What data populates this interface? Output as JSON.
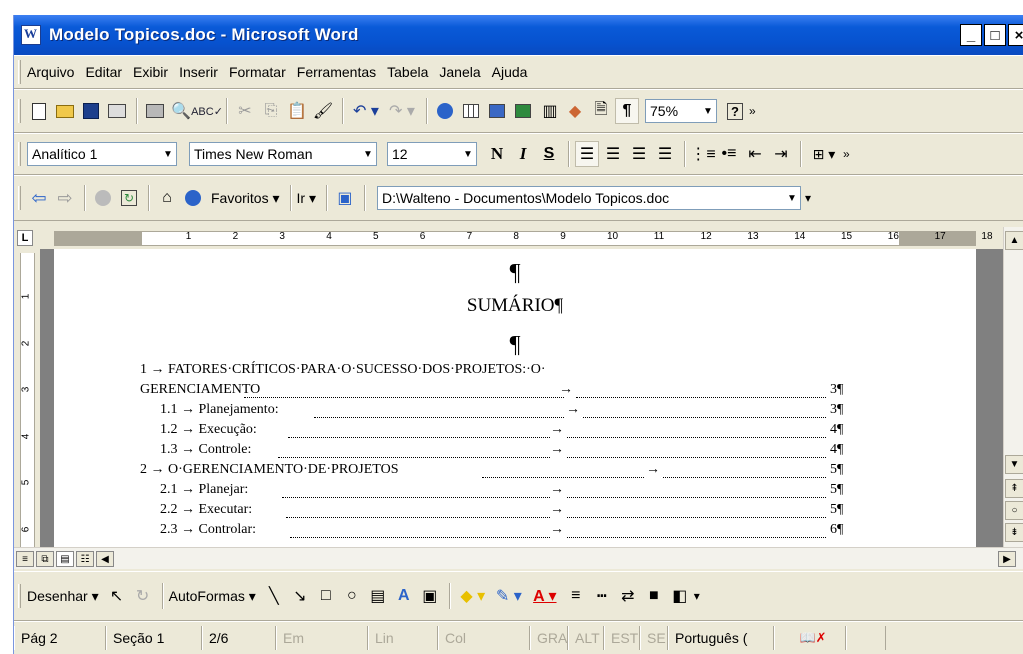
{
  "window": {
    "title": "Modelo Topicos.doc - Microsoft Word"
  },
  "menu": [
    "Arquivo",
    "Editar",
    "Exibir",
    "Inserir",
    "Formatar",
    "Ferramentas",
    "Tabela",
    "Janela",
    "Ajuda"
  ],
  "standard_toolbar": {
    "zoom": "75%"
  },
  "formatting_toolbar": {
    "style": "Analítico 1",
    "font": "Times New Roman",
    "size": "12",
    "bold": "N",
    "italic": "I",
    "underline": "S"
  },
  "web_toolbar": {
    "favorites": "Favoritos",
    "go": "Ir",
    "address": "D:\\Walteno - Documentos\\Modelo Topicos.doc"
  },
  "ruler": {
    "h_numbers": [
      "1",
      "2",
      "3",
      "4",
      "5",
      "6",
      "7",
      "8",
      "9",
      "10",
      "11",
      "12",
      "13",
      "14",
      "15",
      "16",
      "17",
      "18"
    ],
    "v_numbers": [
      "1",
      "2",
      "3",
      "4",
      "5",
      "6"
    ]
  },
  "document": {
    "pilcrow": "¶",
    "title": "SUMÁRIO¶",
    "toc": [
      {
        "text": "1 → FATORES·CRÍTICOS·PARA·O·SUCESSO·DOS·PROJETOS:·O·",
        "page": ""
      },
      {
        "text": "GERENCIAMENTO",
        "page": "3¶"
      },
      {
        "text": "1.1 → Planejamento:",
        "page": "3¶"
      },
      {
        "text": "1.2 → Execução:",
        "page": "4¶"
      },
      {
        "text": "1.3 → Controle:",
        "page": "4¶"
      },
      {
        "text": "2 → O·GERENCIAMENTO·DE·PROJETOS",
        "page": "5¶"
      },
      {
        "text": "2.1 → Planejar:",
        "page": "5¶"
      },
      {
        "text": "2.2 → Executar:",
        "page": "5¶"
      },
      {
        "text": "2.3 → Controlar:",
        "page": "6¶"
      }
    ]
  },
  "drawing_toolbar": {
    "draw": "Desenhar",
    "autoshapes": "AutoFormas"
  },
  "status_bar": {
    "page": "Pág 2",
    "section": "Seção 1",
    "pages": "2/6",
    "at": "Em",
    "line": "Lin",
    "col": "Col",
    "rec": "GRA",
    "trk": "ALT",
    "ext": "EST",
    "ovr": "SE",
    "language": "Português ("
  }
}
